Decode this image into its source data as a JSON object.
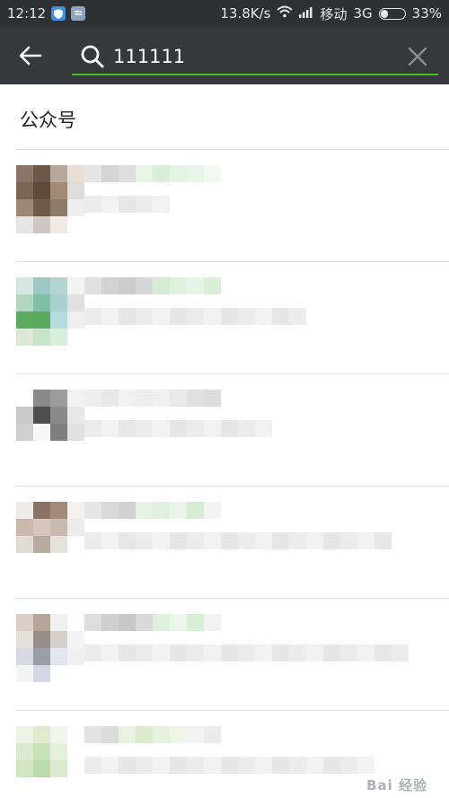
{
  "status_bar": {
    "time": "12:12",
    "speed": "13.8K/s",
    "carrier": "移动",
    "network": "3G",
    "battery": "33%",
    "battery_level": 0.33,
    "icons": [
      "shield-app-icon",
      "notification-app-icon",
      "wifi-icon",
      "signal-icon",
      "battery-icon"
    ]
  },
  "search": {
    "query": "111111",
    "back_icon": "back-arrow-icon",
    "search_icon": "search-icon",
    "clear_icon": "close-icon",
    "accent": "#45c01a"
  },
  "section": {
    "title": "公众号"
  },
  "results": [
    {
      "name": "",
      "description": ""
    },
    {
      "name": "",
      "description": ""
    },
    {
      "name": "",
      "description": ""
    },
    {
      "name": "",
      "description": ""
    },
    {
      "name": "",
      "description": ""
    },
    {
      "name": "",
      "description": ""
    }
  ],
  "watermark": "Bai 经验"
}
